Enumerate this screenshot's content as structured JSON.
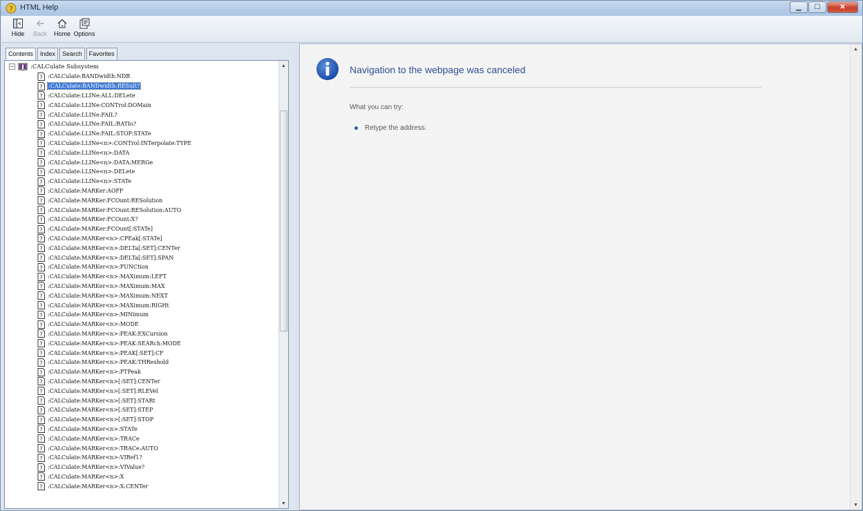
{
  "window": {
    "title": "HTML Help"
  },
  "toolbar": {
    "hide_label": "Hide",
    "back_label": "Back",
    "home_label": "Home",
    "options_label": "Options"
  },
  "tabs": [
    "Contents",
    "Index",
    "Search",
    "Favorites"
  ],
  "tree": {
    "root_label": ":CALCulate Subsystem",
    "items": [
      ":CALCulate:BANDwidth:NDB",
      ":CALCulate:BANDwidth:RESult?",
      ":CALCulate:LLINe:ALL:DELete",
      ":CALCulate:LLINe:CONTrol:DOMain",
      ":CALCulate:LLINe:FAIL?",
      ":CALCulate:LLINe:FAIL:RATIo?",
      ":CALCulate:LLINe:FAIL:STOP:STATe",
      ":CALCulate:LLINe<n>:CONTrol:INTerpolate:TYPE",
      ":CALCulate:LLINe<n>:DATA",
      ":CALCulate:LLINe<n>:DATA:MERGe",
      ":CALCulate:LLINe<n>:DELete",
      ":CALCulate:LLINe<n>:STATe",
      ":CALCulate:MARKer:AOFF",
      ":CALCulate:MARKer:FCOunt:RESolution",
      ":CALCulate:MARKer:FCOunt:RESolution:AUTO",
      ":CALCulate:MARKer:FCOunt:X?",
      ":CALCulate:MARKer:FCOunt[:STATe]",
      ":CALCulate:MARKer<n>:CPEak[:STATe]",
      ":CALCulate:MARKer<n>:DELTa[:SET]:CENTer",
      ":CALCulate:MARKer<n>:DELTa[:SET]:SPAN",
      ":CALCulate:MARKer<n>:FUNCtion",
      ":CALCulate:MARKer<n>:MAXimum:LEFT",
      ":CALCulate:MARKer<n>:MAXimum:MAX",
      ":CALCulate:MARKer<n>:MAXimum:NEXT",
      ":CALCulate:MARKer<n>:MAXimum:RIGHt",
      ":CALCulate:MARKer<n>:MINimum",
      ":CALCulate:MARKer<n>:MODE",
      ":CALCulate:MARKer<n>:PEAK:EXCursion",
      ":CALCulate:MARKer<n>:PEAK:SEARch:MODE",
      ":CALCulate:MARKer<n>:PEAK[:SET]:CF",
      ":CALCulate:MARKer<n>:PEAK:THReshold",
      ":CALCulate:MARKer<n>:PTPeak",
      ":CALCulate:MARKer<n>[:SET]:CENTer",
      ":CALCulate:MARKer<n>[:SET]:RLEVel",
      ":CALCulate:MARKer<n>[:SET]:STARt",
      ":CALCulate:MARKer<n>[:SET]:STEP",
      ":CALCulate:MARKer<n>[:SET]:STOP",
      ":CALCulate:MARKer<n>:STATe",
      ":CALCulate:MARKer<n>:TRACe",
      ":CALCulate:MARKer<n>:TRACe:AUTO",
      ":CALCulate:MARKer<n>:VIRef1?",
      ":CALCulate:MARKer<n>:VIValue?",
      ":CALCulate:MARKer<n>:X",
      ":CALCulate:MARKer<n>:X:CENTer"
    ],
    "selected_index": 1
  },
  "content": {
    "title": "Navigation to the webpage was canceled",
    "try_label": "What you can try:",
    "suggestion": "Retype the address."
  },
  "colors": {
    "selection": "#3a78d6",
    "title_blue": "#2e4e8f"
  }
}
